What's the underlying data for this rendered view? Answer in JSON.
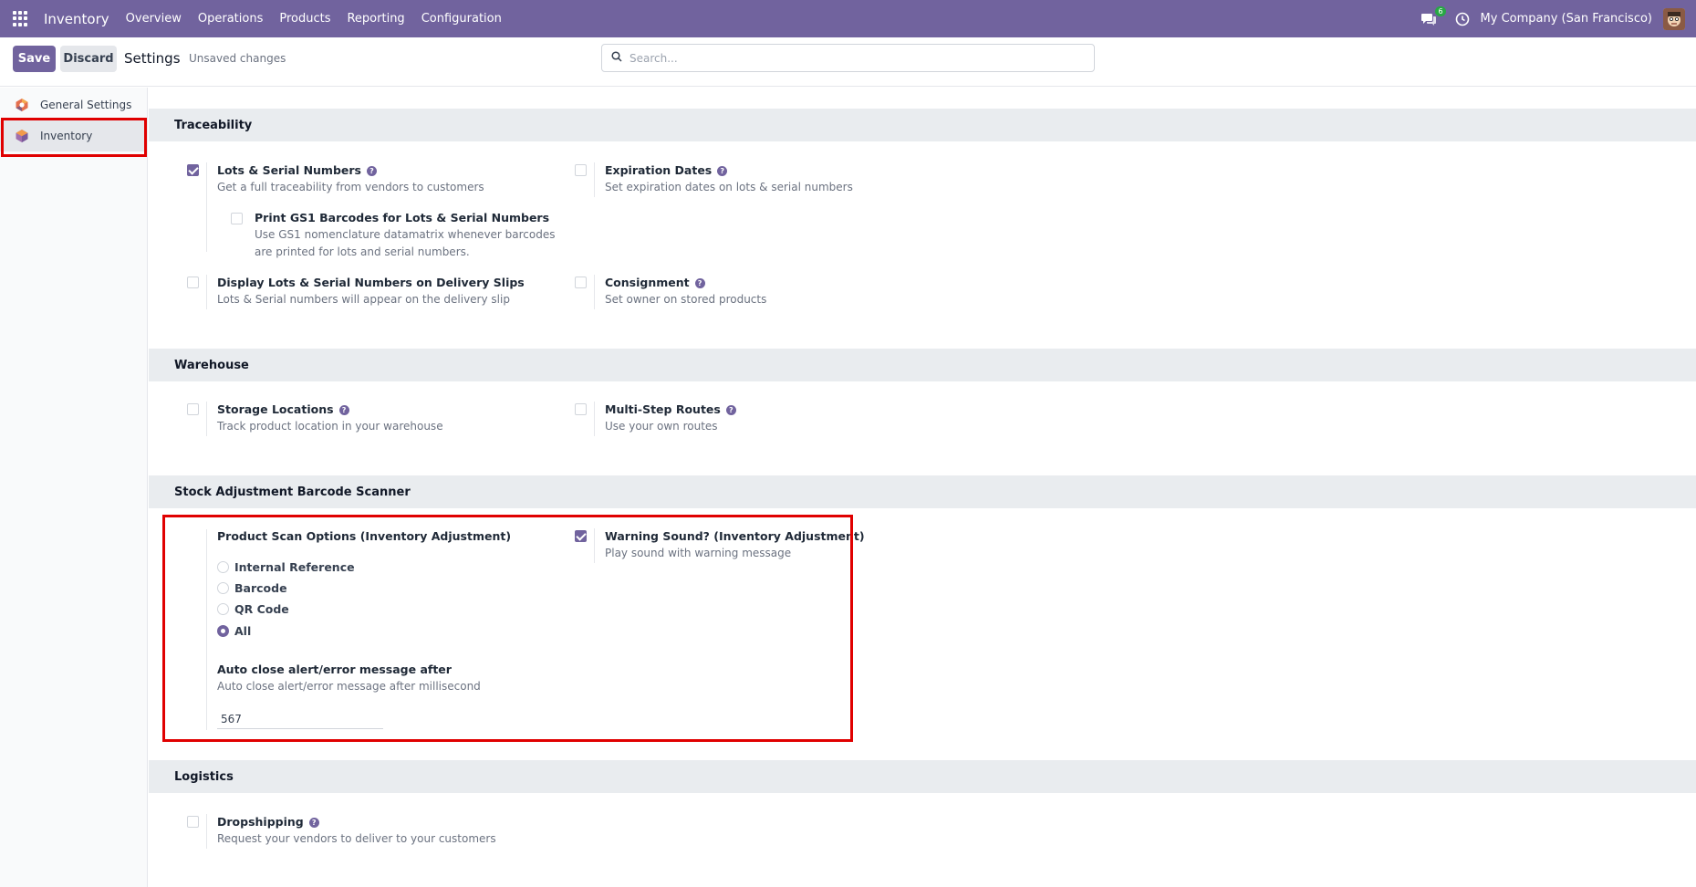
{
  "navbar": {
    "app_name": "Inventory",
    "menu": [
      "Overview",
      "Operations",
      "Products",
      "Reporting",
      "Configuration"
    ],
    "chat_badge": "6",
    "company": "My Company (San Francisco)",
    "accent_color": "#71639e"
  },
  "control": {
    "save_label": "Save",
    "discard_label": "Discard",
    "breadcrumb": "Settings",
    "status": "Unsaved changes",
    "search_placeholder": "Search..."
  },
  "sidebar": {
    "items": [
      {
        "label": "General Settings",
        "icon": "odoo-icon",
        "active": false
      },
      {
        "label": "Inventory",
        "icon": "inventory-icon",
        "active": true
      }
    ]
  },
  "sections": {
    "traceability": {
      "title": "Traceability",
      "lots": {
        "title": "Lots & Serial Numbers",
        "desc": "Get a full traceability from vendors to customers",
        "checked": true
      },
      "gs1": {
        "title": "Print GS1 Barcodes for Lots & Serial Numbers",
        "desc1": "Use GS1 nomenclature datamatrix whenever barcodes",
        "desc2": "are printed for lots and serial numbers.",
        "checked": false
      },
      "expiration": {
        "title": "Expiration Dates",
        "desc": "Set expiration dates on lots & serial numbers",
        "checked": false
      },
      "display_lots": {
        "title": "Display Lots & Serial Numbers on Delivery Slips",
        "desc": "Lots & Serial numbers will appear on the delivery slip",
        "checked": false
      },
      "consignment": {
        "title": "Consignment",
        "desc": "Set owner on stored products",
        "checked": false
      }
    },
    "warehouse": {
      "title": "Warehouse",
      "storage": {
        "title": "Storage Locations",
        "desc": "Track product location in your warehouse",
        "checked": false
      },
      "routes": {
        "title": "Multi-Step Routes",
        "desc": "Use your own routes",
        "checked": false
      }
    },
    "scanner": {
      "title": "Stock Adjustment Barcode Scanner",
      "scan_options": {
        "title": "Product Scan Options (Inventory Adjustment)",
        "options": [
          "Internal Reference",
          "Barcode",
          "QR Code",
          "All"
        ],
        "selected": "All"
      },
      "autoclose": {
        "title": "Auto close alert/error message after",
        "desc": "Auto close alert/error message after millisecond",
        "value": "567"
      },
      "warning": {
        "title": "Warning Sound? (Inventory Adjustment)",
        "desc": "Play sound with warning message",
        "checked": true
      }
    },
    "logistics": {
      "title": "Logistics",
      "dropshipping": {
        "title": "Dropshipping",
        "desc": "Request your vendors to deliver to your customers",
        "checked": false
      }
    }
  }
}
